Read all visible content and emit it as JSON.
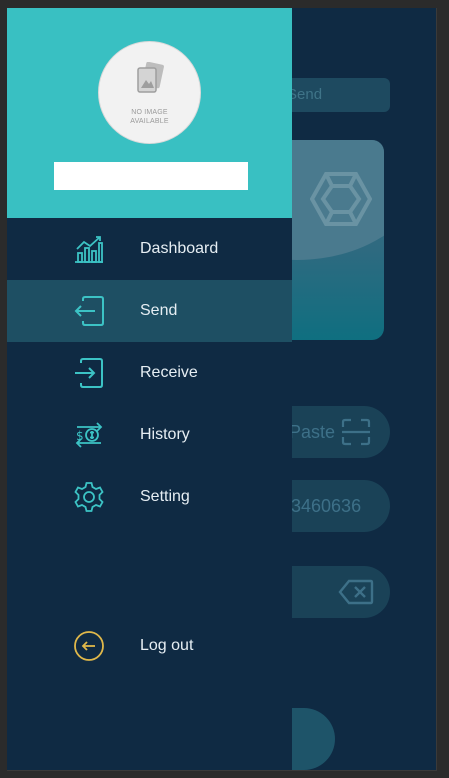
{
  "background": {
    "tab_label": "Send",
    "paste_label": "Paste",
    "number_text": "3460636"
  },
  "drawer": {
    "avatar_text_line1": "NO IMAGE",
    "avatar_text_line2": "AVAILABLE",
    "username": "",
    "items": [
      {
        "label": "Dashboard",
        "icon": "chart-icon",
        "active": false
      },
      {
        "label": "Send",
        "icon": "send-icon",
        "active": true
      },
      {
        "label": "Receive",
        "icon": "receive-icon",
        "active": false
      },
      {
        "label": "History",
        "icon": "history-icon",
        "active": false
      },
      {
        "label": "Setting",
        "icon": "gear-icon",
        "active": false
      },
      {
        "label": "Log out",
        "icon": "logout-icon",
        "active": false
      }
    ]
  },
  "colors": {
    "header_teal": "#39c0c2",
    "drawer_bg": "#0f2a43",
    "active_item": "#1e4f63",
    "icon_teal": "#3cc3c5",
    "logout_gold": "#e0b84a"
  }
}
